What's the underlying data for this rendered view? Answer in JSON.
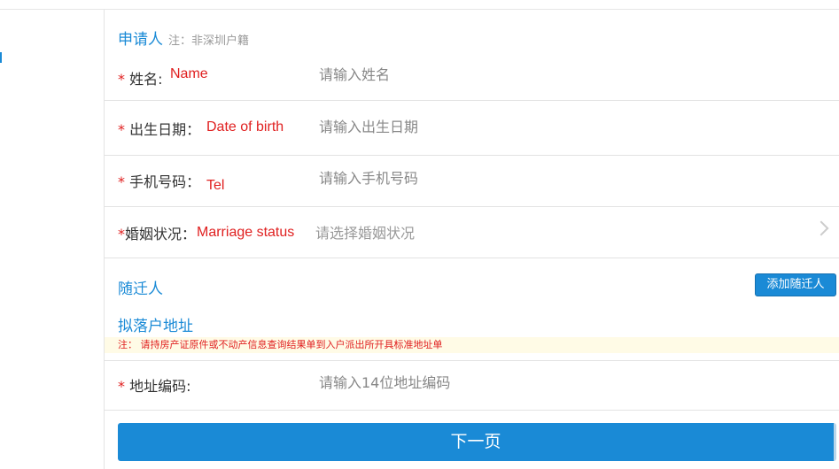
{
  "applicant": {
    "title": "申请人",
    "note": "注：非深圳户籍",
    "fields": [
      {
        "required_mark": "*",
        "label": "姓名:",
        "annotation": "Name",
        "placeholder": "请输入姓名"
      },
      {
        "required_mark": "*",
        "label": "出生日期：",
        "annotation": "Date of birth",
        "placeholder": "请输入出生日期"
      },
      {
        "required_mark": "*",
        "label": "手机号码：",
        "annotation": "Tel",
        "placeholder": "请输入手机号码"
      },
      {
        "required_mark": "*",
        "label": "婚姻状况：",
        "annotation": "Marriage status",
        "placeholder": "请选择婚姻状况"
      }
    ]
  },
  "dependents": {
    "title": "随迁人",
    "add_button": "添加随迁人"
  },
  "address": {
    "title": "拟落户地址",
    "notice": "注：  请持房产证原件或不动产信息查询结果单到入户派出所开具标准地址单",
    "field": {
      "required_mark": "*",
      "label": "地址编码:",
      "placeholder": "请输入14位地址编码"
    }
  },
  "next_button": "下一页",
  "colors": {
    "accent": "#1a8ad6",
    "required": "#e02020",
    "notice_bg": "#fffbe6"
  }
}
